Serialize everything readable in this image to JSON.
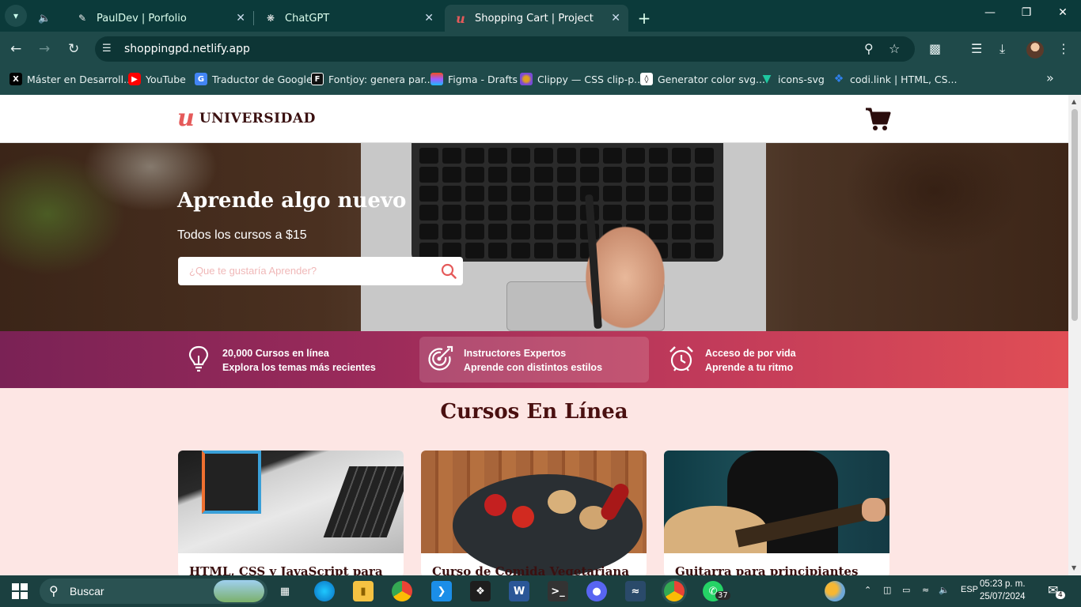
{
  "browser": {
    "tabs": [
      {
        "title": "PaulDev | Porfolio",
        "icon": "pauldev-favicon"
      },
      {
        "title": "ChatGPT",
        "icon": "chatgpt-favicon"
      },
      {
        "title": "Shopping Cart | Project",
        "icon": "udemy-favicon",
        "active": true
      }
    ],
    "new_tab_label": "+",
    "url": "shoppingpd.netlify.app",
    "bookmarks": [
      {
        "label": "Máster en Desarroll...",
        "icon": "x-icon",
        "color": "#000000"
      },
      {
        "label": "YouTube",
        "icon": "youtube-icon",
        "color": "#ff0000"
      },
      {
        "label": "Traductor de Google",
        "icon": "translate-icon",
        "color": "#4285f4"
      },
      {
        "label": "Fontjoy: genera par...",
        "icon": "fontjoy-icon",
        "color": "#111111"
      },
      {
        "label": "Figma - Drafts",
        "icon": "figma-icon",
        "color": "#f24e1e"
      },
      {
        "label": "Clippy — CSS clip-p...",
        "icon": "clippy-icon",
        "color": "#e0a020"
      },
      {
        "label": "Generator color svg...",
        "icon": "svg-icon",
        "color": "#ffffff"
      },
      {
        "label": "icons-svg",
        "icon": "icons-svg-icon",
        "color": "#1ec8a0"
      },
      {
        "label": "codi.link | HTML, CS...",
        "icon": "codilink-icon",
        "color": "#2f80ed"
      }
    ]
  },
  "site": {
    "brand_mark": "u",
    "brand_name": "UNIVERSIDAD",
    "hero": {
      "title": "Aprende algo nuevo",
      "subtitle": "Todos los cursos a $15",
      "search_placeholder": "¿Que te gustaría Aprender?"
    },
    "features": [
      {
        "line1": "20,000 Cursos en línea",
        "line2": "Explora los temas más recientes",
        "icon": "lightbulb-icon"
      },
      {
        "line1": "Instructores Expertos",
        "line2": "Aprende con distintos estilos",
        "icon": "target-icon"
      },
      {
        "line1": "Acceso de por vida",
        "line2": "Aprende a tu ritmo",
        "icon": "alarm-clock-icon"
      }
    ],
    "section_title": "Cursos En Línea",
    "courses": [
      {
        "title": "HTML, CSS y JavaScript para"
      },
      {
        "title": "Curso de Comida Vegetariana"
      },
      {
        "title": "Guitarra para principiantes"
      }
    ]
  },
  "taskbar": {
    "search_label": "Buscar",
    "language": "ESP",
    "time": "05:23 p. m.",
    "date": "25/07/2024",
    "whatsapp_badge": "37",
    "notification_badge": "4"
  },
  "colors": {
    "accent": "#e55a5a",
    "brand_dark": "#3a1010",
    "features_start": "#7a2255",
    "features_end": "#e04e55",
    "page_bg": "#fde6e4"
  }
}
